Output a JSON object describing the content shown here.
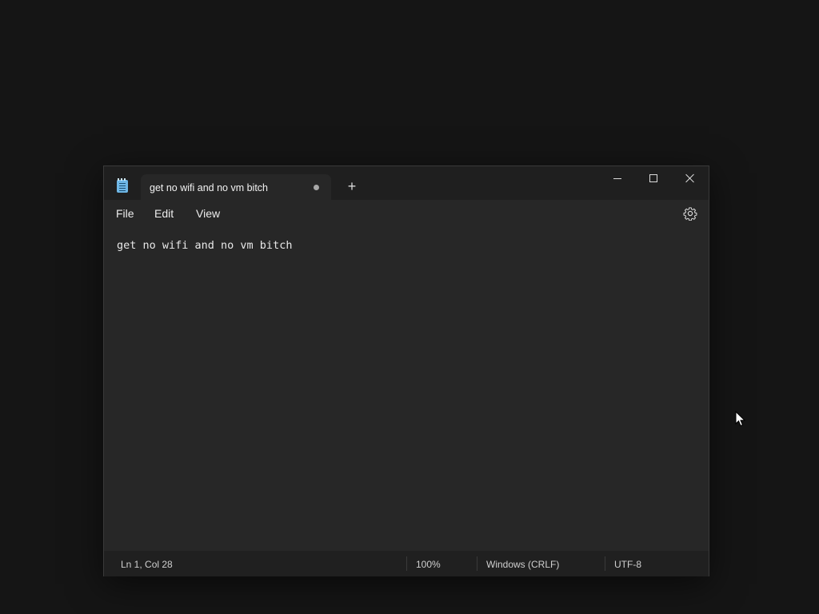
{
  "window": {
    "tab_title": "get no wifi and no vm bitch",
    "new_tab_label": "+",
    "icons": [
      "notepad-app-icon",
      "unsaved-dot-icon",
      "minimize-icon",
      "maximize-icon",
      "close-icon",
      "gear-icon",
      "mouse-cursor-icon"
    ]
  },
  "menu": {
    "file": "File",
    "edit": "Edit",
    "view": "View"
  },
  "editor": {
    "content": "get no wifi and no vm bitch"
  },
  "status": {
    "position": "Ln 1, Col 28",
    "zoom": "100%",
    "line_ending": "Windows (CRLF)",
    "encoding": "UTF-8"
  },
  "colors": {
    "background": "#151515",
    "window": "#272727",
    "titlebar": "#1f1f1f",
    "statusbar": "#202020",
    "icon_accent": "#6fb7e6"
  }
}
